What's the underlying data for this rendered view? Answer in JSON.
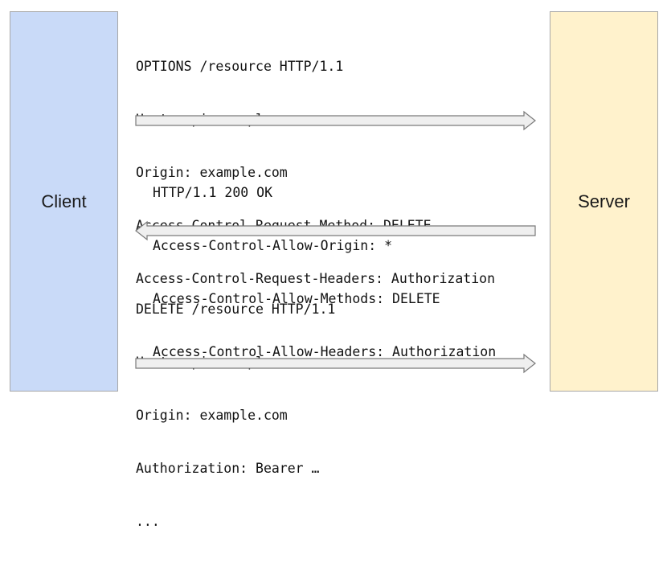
{
  "participants": {
    "client": "Client",
    "server": "Server"
  },
  "messages": [
    {
      "id": "preflight-request",
      "direction": "client-to-server",
      "lines": [
        "OPTIONS /resource HTTP/1.1",
        "Host: api.example.com",
        "Origin: example.com",
        "Access-Control-Request-Method: DELETE",
        "Access-Control-Request-Headers: Authorization"
      ]
    },
    {
      "id": "preflight-response",
      "direction": "server-to-client",
      "lines": [
        "HTTP/1.1 200 OK",
        "Access-Control-Allow-Origin: *",
        "Access-Control-Allow-Methods: DELETE",
        "Access-Control-Allow-Headers: Authorization"
      ]
    },
    {
      "id": "actual-request",
      "direction": "client-to-server",
      "lines": [
        "DELETE /resource HTTP/1.1",
        "Host: api.example.com",
        "Origin: example.com",
        "Authorization: Bearer …",
        "..."
      ]
    }
  ],
  "colors": {
    "client_fill": "#c9daf8",
    "server_fill": "#fff2cc",
    "box_border": "#a8a8a8",
    "arrow_fill": "#efefef",
    "arrow_stroke": "#7a7a7a"
  }
}
